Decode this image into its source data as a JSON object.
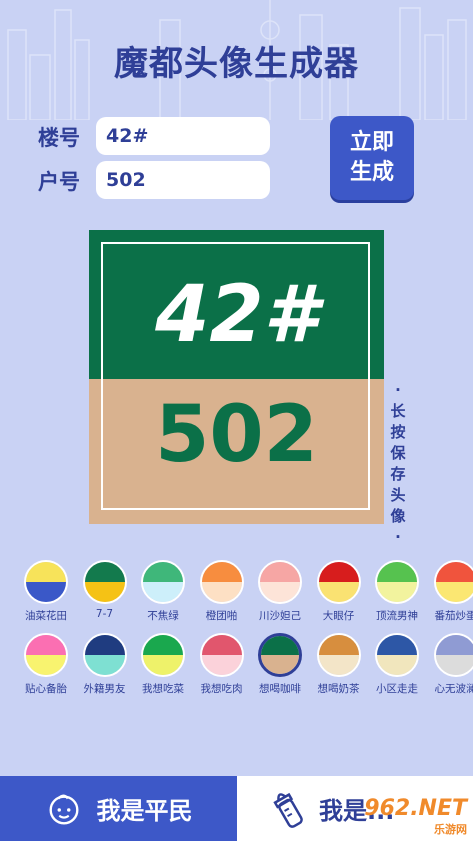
{
  "header": {
    "title": "魔都头像生成器"
  },
  "form": {
    "building_label": "楼号",
    "building_value": "42#",
    "unit_label": "户号",
    "unit_value": "502",
    "generate_label_1": "立即",
    "generate_label_2": "生成"
  },
  "avatar": {
    "line1": "42#",
    "line2": "502",
    "top_color": "#0b7048",
    "bottom_color": "#d9b28f"
  },
  "save_hint": [
    "·",
    "长",
    "按",
    "保",
    "存",
    "头",
    "像",
    "·"
  ],
  "swatches": [
    {
      "label": "油菜花田",
      "top": "#f7e35a",
      "bottom": "#3a58c8"
    },
    {
      "label": "7-7",
      "top": "#137a4d",
      "bottom": "#f5c215"
    },
    {
      "label": "不焦绿",
      "top": "#3fb77a",
      "bottom": "#cdeffa"
    },
    {
      "label": "橙团啪",
      "top": "#f78d3f",
      "bottom": "#fde0c4"
    },
    {
      "label": "川沙妲己",
      "top": "#f6a6a4",
      "bottom": "#fde4d8"
    },
    {
      "label": "大眼仔",
      "top": "#d71d1d",
      "bottom": "#fae272"
    },
    {
      "label": "顶流男神",
      "top": "#56c24f",
      "bottom": "#f2f39e"
    },
    {
      "label": "番茄炒蛋",
      "top": "#f0543d",
      "bottom": "#fbe772"
    },
    {
      "label": "贴心备胎",
      "top": "#fb6fb2",
      "bottom": "#f8f36f"
    },
    {
      "label": "外籍男友",
      "top": "#1f3c80",
      "bottom": "#7ee0d2"
    },
    {
      "label": "我想吃菜",
      "top": "#1aa84e",
      "bottom": "#eef26a"
    },
    {
      "label": "我想吃肉",
      "top": "#e1566d",
      "bottom": "#fbd2da"
    },
    {
      "label": "想喝咖啡",
      "top": "#0b7048",
      "bottom": "#d9b28f",
      "selected": true
    },
    {
      "label": "想喝奶茶",
      "top": "#d78e3e",
      "bottom": "#f3e5c8"
    },
    {
      "label": "小区走走",
      "top": "#2d57a6",
      "bottom": "#f1e6bd"
    },
    {
      "label": "心无波澜",
      "top": "#8f9bd3",
      "bottom": "#dcdcdc"
    }
  ],
  "bottom_nav": {
    "left_label": "我是平民",
    "right_label": "我是...",
    "left_icon": "baby-face-icon",
    "right_icon": "baby-bottle-icon"
  },
  "watermark": {
    "main": "962.NET",
    "sub": "乐游网"
  }
}
